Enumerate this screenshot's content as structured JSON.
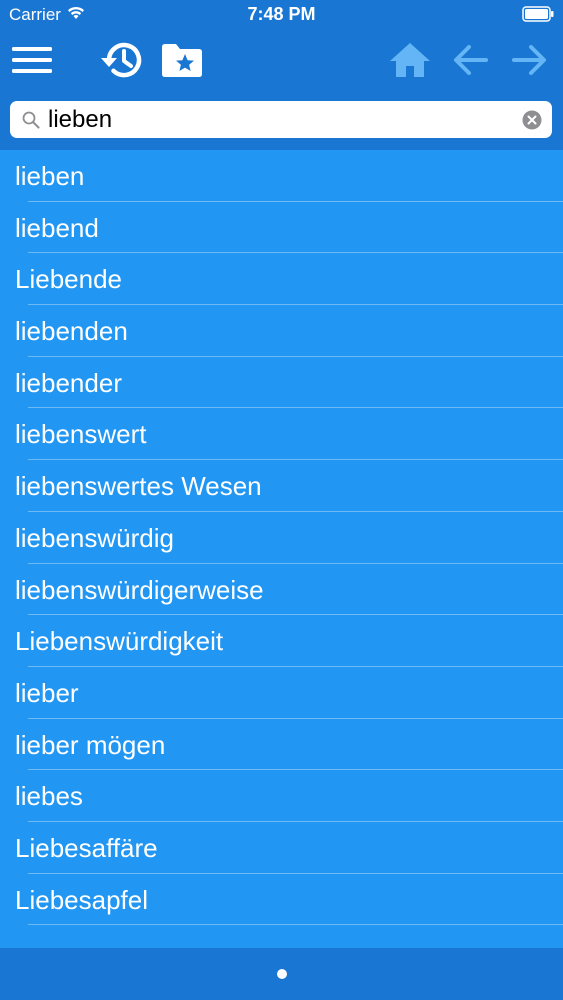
{
  "status_bar": {
    "carrier": "Carrier",
    "time": "7:48 PM"
  },
  "toolbar": {
    "icons": [
      "menu-icon",
      "history-icon",
      "favorites-folder-icon",
      "home-icon",
      "back-arrow-icon",
      "forward-arrow-icon"
    ],
    "colors": {
      "toolbar_bg": "#1976d2",
      "list_bg": "#2196f3",
      "disabled_icon": "#64b5f6",
      "active_icon": "#ffffff"
    }
  },
  "search": {
    "value": "lieben"
  },
  "results": [
    {
      "label": "lieben"
    },
    {
      "label": "liebend"
    },
    {
      "label": "Liebende"
    },
    {
      "label": "liebenden"
    },
    {
      "label": "liebender"
    },
    {
      "label": "liebenswert"
    },
    {
      "label": "liebenswertes Wesen"
    },
    {
      "label": "liebenswürdig"
    },
    {
      "label": "liebenswürdigerweise"
    },
    {
      "label": "Liebenswürdigkeit"
    },
    {
      "label": "lieber"
    },
    {
      "label": "lieber mögen"
    },
    {
      "label": "liebes"
    },
    {
      "label": "Liebesaffäre"
    },
    {
      "label": "Liebesapfel"
    }
  ]
}
